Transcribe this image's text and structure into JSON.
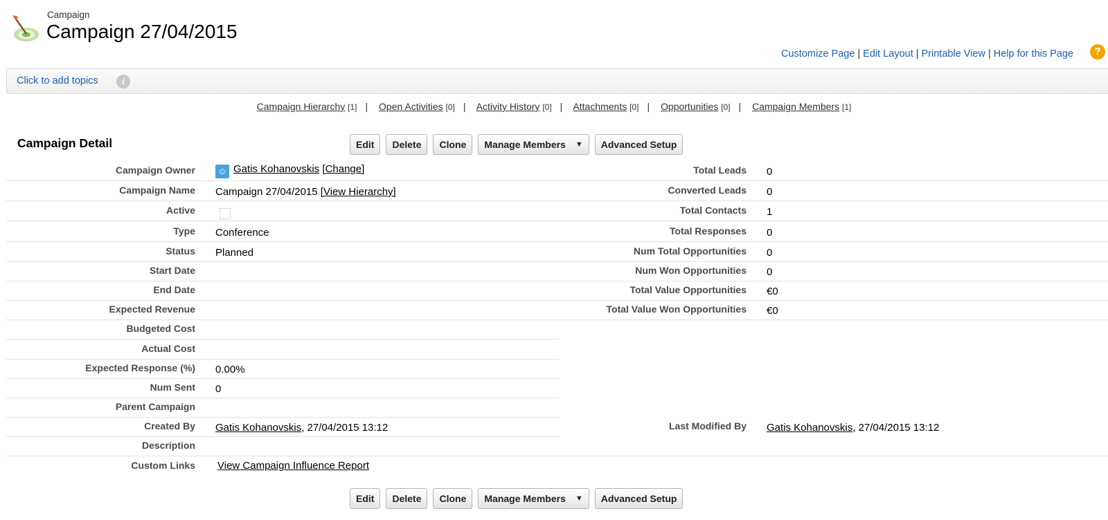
{
  "header": {
    "object_type": "Campaign",
    "title": "Campaign 27/04/2015",
    "logo_icon": "campaign-target-icon"
  },
  "help_links": [
    "Customize Page",
    "Edit Layout",
    "Printable View",
    "Help for this Page"
  ],
  "topics": {
    "link": "Click to add topics",
    "info_icon": "info-icon"
  },
  "related_lists": [
    {
      "label": "Campaign Hierarchy",
      "count": "[1]"
    },
    {
      "label": "Open Activities",
      "count": "[0]"
    },
    {
      "label": "Activity History",
      "count": "[0]"
    },
    {
      "label": "Attachments",
      "count": "[0]"
    },
    {
      "label": "Opportunities",
      "count": "[0]"
    },
    {
      "label": "Campaign Members",
      "count": "[1]"
    }
  ],
  "detail": {
    "section_title": "Campaign Detail",
    "buttons": {
      "edit": "Edit",
      "delete": "Delete",
      "clone": "Clone",
      "manage_members": "Manage Members",
      "advanced_setup": "Advanced Setup"
    },
    "left": {
      "owner_label": "Campaign Owner",
      "owner_name": "Gatis Kohanovskis",
      "owner_change": "[Change]",
      "name_label": "Campaign Name",
      "name_value": "Campaign 27/04/2015",
      "name_view_hierarchy": "[View Hierarchy]",
      "active_label": "Active",
      "type_label": "Type",
      "type_value": "Conference",
      "status_label": "Status",
      "status_value": "Planned",
      "start_label": "Start Date",
      "end_label": "End Date",
      "exp_revenue_label": "Expected Revenue",
      "budgeted_label": "Budgeted Cost",
      "actual_label": "Actual Cost",
      "exp_response_label": "Expected Response (%)",
      "exp_response_value": "0.00%",
      "num_sent_label": "Num Sent",
      "num_sent_value": "0",
      "parent_label": "Parent Campaign",
      "created_label": "Created By",
      "created_by": "Gatis Kohanovskis",
      "created_date": ", 27/04/2015 13:12",
      "description_label": "Description",
      "custom_links_label": "Custom Links",
      "custom_link": "View Campaign Influence Report"
    },
    "right": {
      "total_leads_label": "Total Leads",
      "total_leads_value": "0",
      "converted_leads_label": "Converted Leads",
      "converted_leads_value": "0",
      "total_contacts_label": "Total Contacts",
      "total_contacts_value": "1",
      "total_responses_label": "Total Responses",
      "total_responses_value": "0",
      "num_total_opps_label": "Num Total Opportunities",
      "num_total_opps_value": "0",
      "num_won_opps_label": "Num Won Opportunities",
      "num_won_opps_value": "0",
      "total_value_opps_label": "Total Value Opportunities",
      "total_value_opps_value": "€0",
      "total_value_won_label": "Total Value Won Opportunities",
      "total_value_won_value": "€0",
      "last_modified_label": "Last Modified By",
      "last_modified_by": "Gatis Kohanovskis",
      "last_modified_date": ", 27/04/2015 13:12"
    }
  }
}
